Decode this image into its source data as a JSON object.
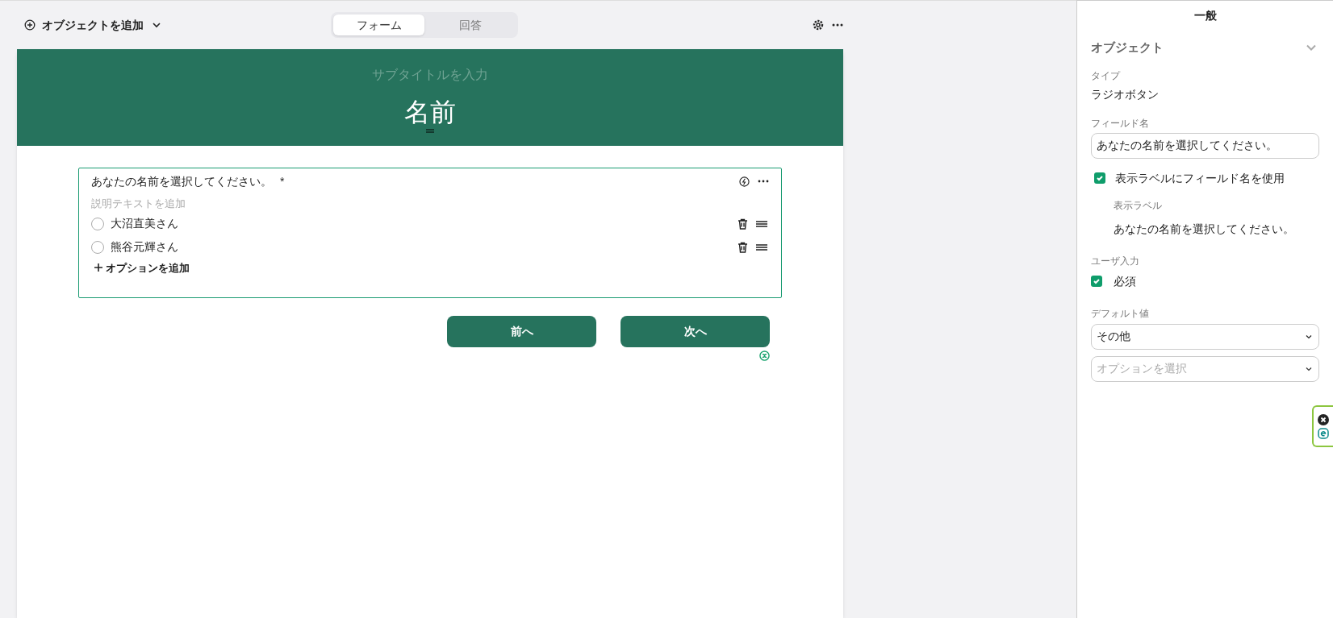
{
  "toolbar": {
    "add_object": "オブジェクトを追加",
    "tabs": [
      {
        "label": "フォーム",
        "selected": true
      },
      {
        "label": "回答",
        "selected": false
      }
    ]
  },
  "header": {
    "subtitle_placeholder": "サブタイトルを入力",
    "title": "名前"
  },
  "question": {
    "label": "あなたの名前を選択してください。",
    "required_mark": "*",
    "description_placeholder": "説明テキストを追加",
    "options": [
      {
        "label": "大沼直美さん",
        "selected": false
      },
      {
        "label": "熊谷元輝さん",
        "selected": false
      }
    ],
    "add_option": "オプションを追加"
  },
  "buttons": [
    {
      "label": "前へ"
    },
    {
      "label": "次へ"
    }
  ],
  "panel": {
    "title": "一般",
    "section": "オブジェクト",
    "type_label": "タイプ",
    "type_value": "ラジオボタン",
    "field_name_label": "フィールド名",
    "field_name_value": "あなたの名前を選択してください。",
    "use_field_name": {
      "label": "表示ラベルにフィールド名を使用",
      "checked": true
    },
    "display_label_label": "表示ラベル",
    "display_label_value": "あなたの名前を選択してください。",
    "user_input_label": "ユーザ入力",
    "required": {
      "label": "必須",
      "checked": true
    },
    "default_label": "デフォルト値",
    "default_value": "その他",
    "option_placeholder": "オプションを選択"
  }
}
